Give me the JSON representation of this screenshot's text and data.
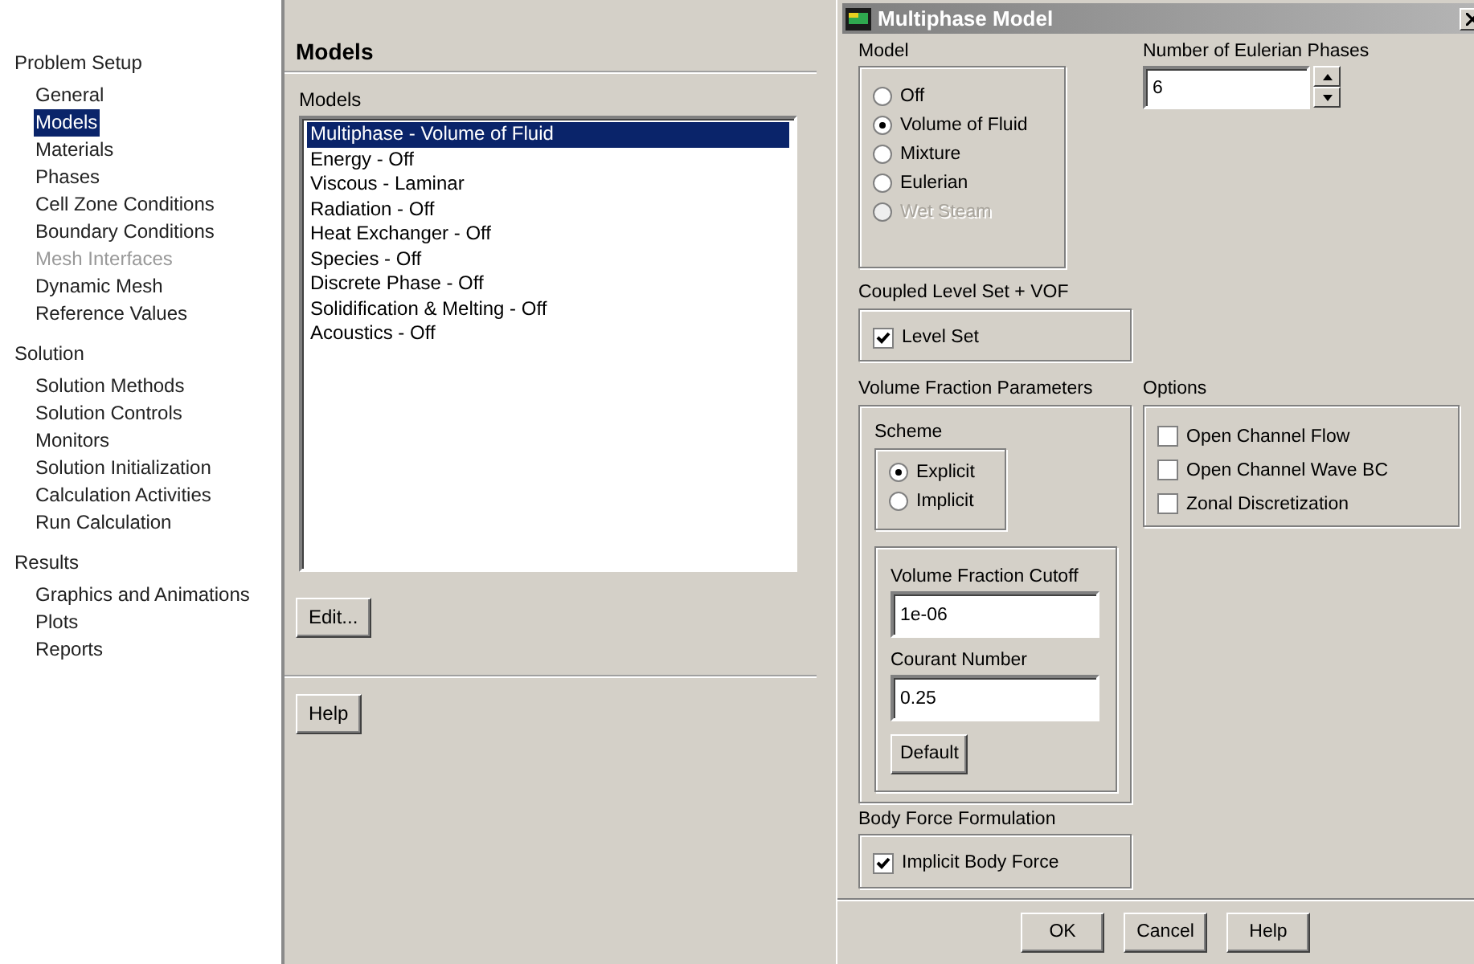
{
  "nav": {
    "sections": [
      {
        "label": "Problem Setup",
        "items": [
          {
            "label": "General",
            "selected": false,
            "disabled": false
          },
          {
            "label": "Models",
            "selected": true,
            "disabled": false
          },
          {
            "label": "Materials",
            "selected": false,
            "disabled": false
          },
          {
            "label": "Phases",
            "selected": false,
            "disabled": false
          },
          {
            "label": "Cell Zone Conditions",
            "selected": false,
            "disabled": false
          },
          {
            "label": "Boundary Conditions",
            "selected": false,
            "disabled": false
          },
          {
            "label": "Mesh Interfaces",
            "selected": false,
            "disabled": true
          },
          {
            "label": "Dynamic Mesh",
            "selected": false,
            "disabled": false
          },
          {
            "label": "Reference Values",
            "selected": false,
            "disabled": false
          }
        ]
      },
      {
        "label": "Solution",
        "items": [
          {
            "label": "Solution Methods",
            "selected": false,
            "disabled": false
          },
          {
            "label": "Solution Controls",
            "selected": false,
            "disabled": false
          },
          {
            "label": "Monitors",
            "selected": false,
            "disabled": false
          },
          {
            "label": "Solution Initialization",
            "selected": false,
            "disabled": false
          },
          {
            "label": "Calculation Activities",
            "selected": false,
            "disabled": false
          },
          {
            "label": "Run Calculation",
            "selected": false,
            "disabled": false
          }
        ]
      },
      {
        "label": "Results",
        "items": [
          {
            "label": "Graphics and Animations",
            "selected": false,
            "disabled": false
          },
          {
            "label": "Plots",
            "selected": false,
            "disabled": false
          },
          {
            "label": "Reports",
            "selected": false,
            "disabled": false
          }
        ]
      }
    ]
  },
  "models_panel": {
    "title": "Models",
    "list_label": "Models",
    "list": [
      {
        "label": "Multiphase - Volume of Fluid",
        "selected": true
      },
      {
        "label": "Energy - Off",
        "selected": false
      },
      {
        "label": "Viscous - Laminar",
        "selected": false
      },
      {
        "label": "Radiation - Off",
        "selected": false
      },
      {
        "label": "Heat Exchanger - Off",
        "selected": false
      },
      {
        "label": "Species - Off",
        "selected": false
      },
      {
        "label": "Discrete Phase - Off",
        "selected": false
      },
      {
        "label": "Solidification & Melting - Off",
        "selected": false
      },
      {
        "label": "Acoustics - Off",
        "selected": false
      }
    ],
    "edit_button": "Edit...",
    "help_button": "Help"
  },
  "dialog": {
    "title": "Multiphase Model",
    "model": {
      "label": "Model",
      "options": [
        {
          "label": "Off",
          "selected": false,
          "disabled": false
        },
        {
          "label": "Volume of Fluid",
          "selected": true,
          "disabled": false
        },
        {
          "label": "Mixture",
          "selected": false,
          "disabled": false
        },
        {
          "label": "Eulerian",
          "selected": false,
          "disabled": false
        },
        {
          "label": "Wet Steam",
          "selected": false,
          "disabled": true
        }
      ]
    },
    "phases": {
      "label": "Number of Eulerian Phases",
      "value": "6"
    },
    "level_set": {
      "label": "Coupled Level Set + VOF",
      "checkbox": {
        "label": "Level Set",
        "checked": true
      }
    },
    "volume_fraction": {
      "label": "Volume Fraction Parameters",
      "scheme": {
        "label": "Scheme",
        "options": [
          {
            "label": "Explicit",
            "selected": true
          },
          {
            "label": "Implicit",
            "selected": false
          }
        ]
      },
      "cutoff": {
        "label": "Volume Fraction Cutoff",
        "value": "1e-06"
      },
      "courant": {
        "label": "Courant Number",
        "value": "0.25"
      },
      "default_button": "Default"
    },
    "options": {
      "label": "Options",
      "items": [
        {
          "label": "Open Channel Flow",
          "checked": false
        },
        {
          "label": "Open Channel Wave BC",
          "checked": false
        },
        {
          "label": "Zonal Discretization",
          "checked": false
        }
      ]
    },
    "body_force": {
      "label": "Body Force Formulation",
      "checkbox": {
        "label": "Implicit Body Force",
        "checked": true
      }
    },
    "buttons": [
      "OK",
      "Cancel",
      "Help"
    ]
  }
}
